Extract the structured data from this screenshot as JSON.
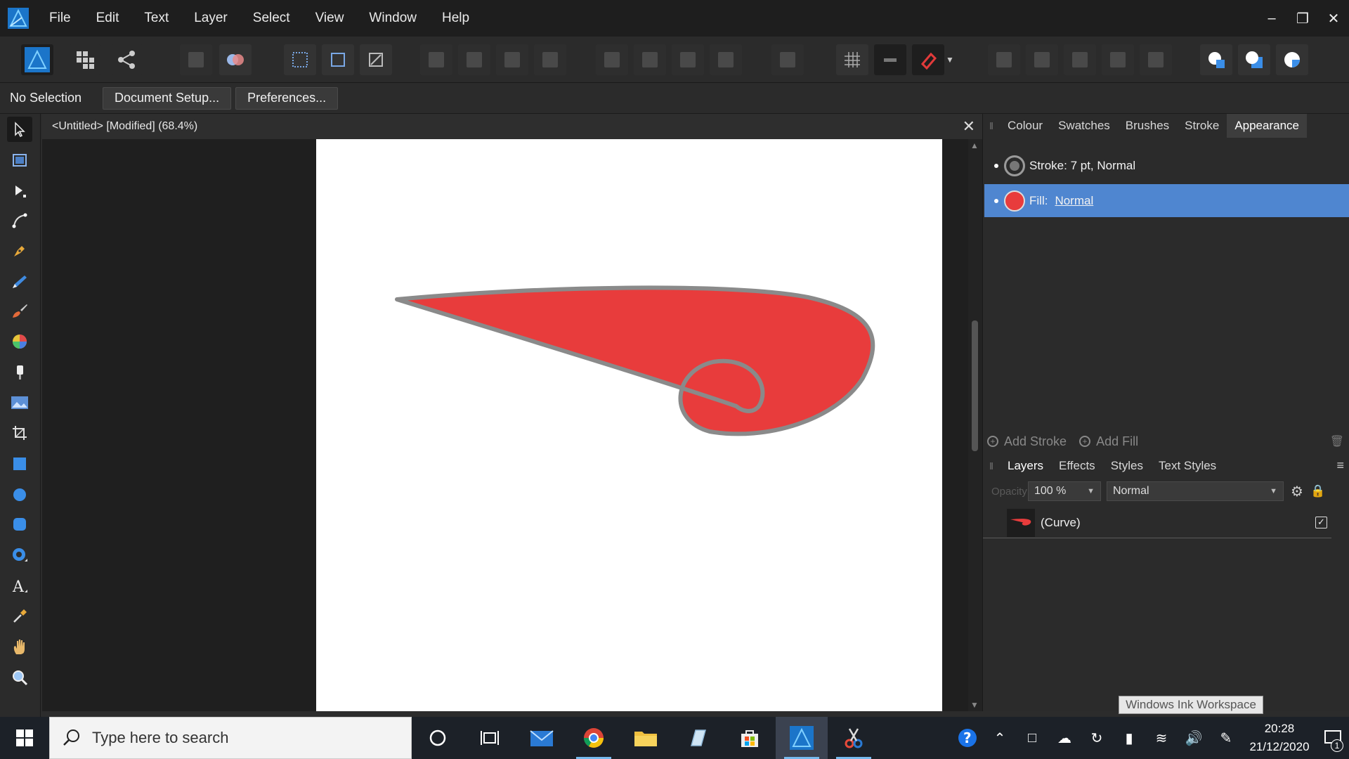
{
  "menubar": {
    "items": [
      "File",
      "Edit",
      "Text",
      "Layer",
      "Select",
      "View",
      "Window",
      "Help"
    ]
  },
  "context": {
    "selection_label": "No Selection",
    "document_setup_label": "Document Setup...",
    "preferences_label": "Preferences..."
  },
  "document": {
    "tab_title": "<Untitled> [Modified] (68.4%)",
    "fill_color": "#e83c3c",
    "stroke_color": "#8a8a8a"
  },
  "panel_top": {
    "tabs": [
      "Colour",
      "Swatches",
      "Brushes",
      "Stroke",
      "Appearance"
    ],
    "active_tab": "Appearance",
    "stroke_row": "Stroke: 7 pt,  Normal",
    "fill_label": "Fill:",
    "fill_blend": "Normal",
    "add_stroke": "Add Stroke",
    "add_fill": "Add Fill"
  },
  "panel_bottom": {
    "tabs": [
      "Layers",
      "Effects",
      "Styles",
      "Text Styles"
    ],
    "active_tab": "Layers",
    "opacity_label": "Opacity:",
    "opacity_value": "100 %",
    "blend_mode": "Normal",
    "layer_name": "(Curve)"
  },
  "tooltip": "Windows Ink Workspace",
  "taskbar": {
    "search_placeholder": "Type here to search",
    "time": "20:28",
    "date": "21/12/2020",
    "notification_count": "1"
  },
  "colors": {
    "accent_selection": "#4f86d0",
    "affinity_blue": "#2a8fe0"
  }
}
